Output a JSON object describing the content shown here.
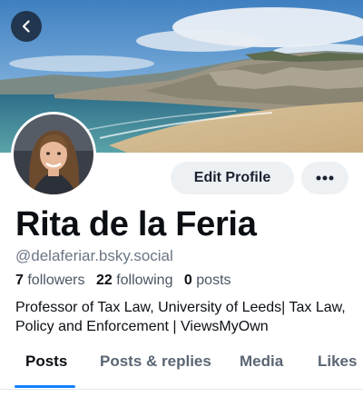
{
  "profile": {
    "name": "Rita de la Feria",
    "handle": "@delaferiar.bsky.social",
    "stats": {
      "followers_count": "7",
      "followers_label": "followers",
      "following_count": "22",
      "following_label": "following",
      "posts_count": "0",
      "posts_label": "posts"
    },
    "bio": "Professor of Tax Law, University of Leeds| Tax Law, Policy and Enforcement | ViewsMyOwn"
  },
  "actions": {
    "edit_label": "Edit Profile",
    "more_icon": "ellipsis-icon",
    "back_icon": "chevron-left-icon"
  },
  "tabs": [
    {
      "label": "Posts",
      "active": true
    },
    {
      "label": "Posts & replies",
      "active": false
    },
    {
      "label": "Media",
      "active": false
    },
    {
      "label": "Likes",
      "active": false
    }
  ],
  "colors": {
    "accent": "#1083fe",
    "button_bg": "#eef1f4",
    "muted_text": "#6b7684"
  }
}
